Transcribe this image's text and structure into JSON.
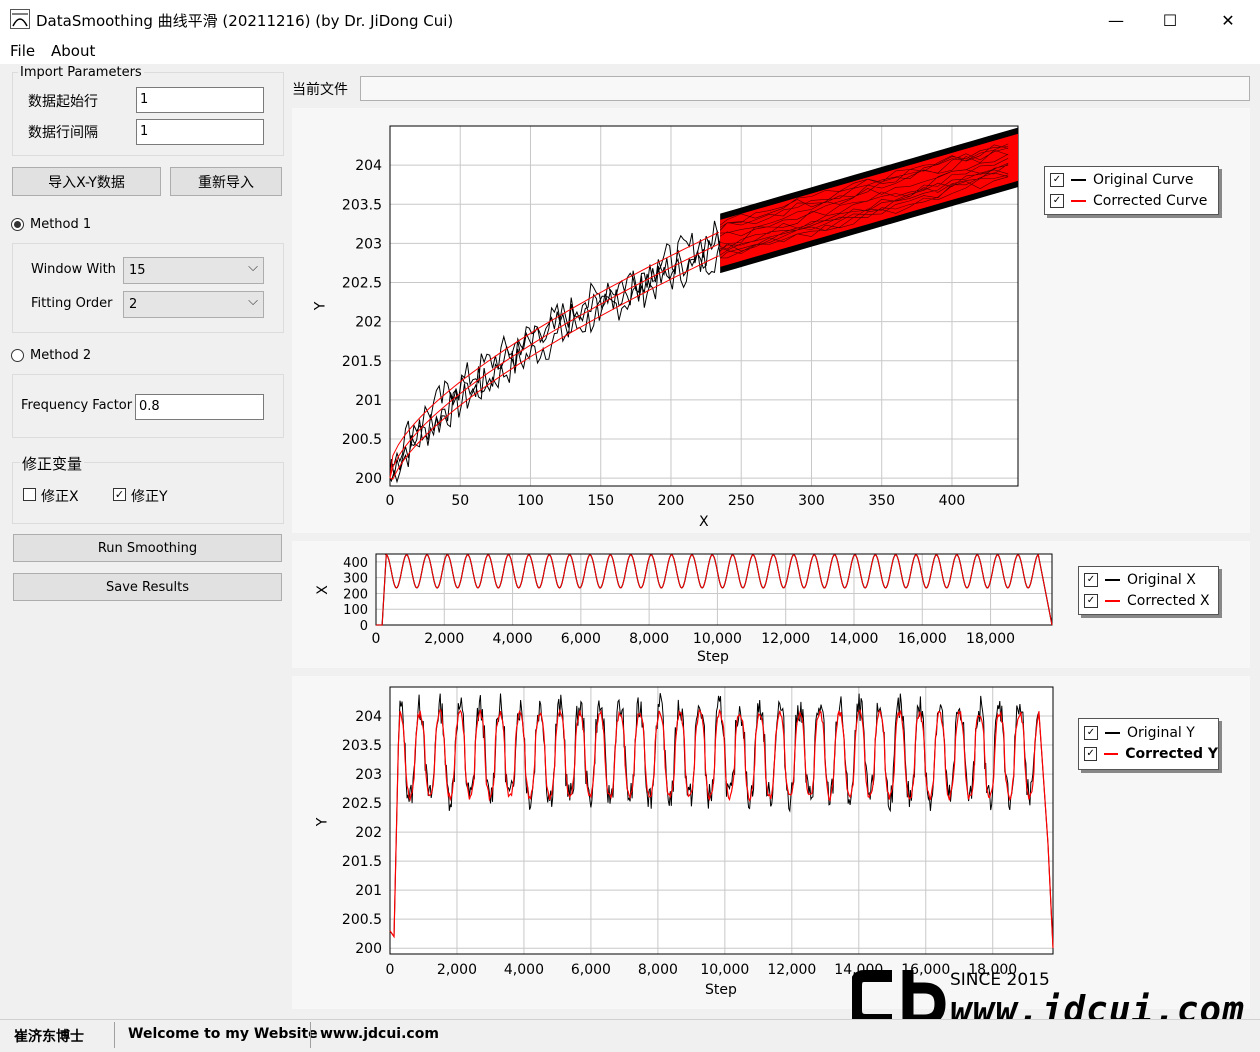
{
  "window": {
    "title": "DataSmoothing 曲线平滑 (20211216) (by Dr. JiDong Cui)",
    "minimize": "—",
    "maximize": "☐",
    "close": "✕"
  },
  "menu": [
    "File",
    "About"
  ],
  "import_params": {
    "title": "Import Parameters",
    "start_row_label": "数据起始行",
    "start_row_value": "1",
    "row_interval_label": "数据行间隔",
    "row_interval_value": "1"
  },
  "buttons": {
    "import_xy": "导入X-Y数据",
    "reimport": "重新导入",
    "run": "Run Smoothing",
    "save": "Save Results"
  },
  "method1": {
    "label": "Method 1",
    "selected": true,
    "window_label": "Window With",
    "window_value": "15",
    "order_label": "Fitting Order",
    "order_value": "2"
  },
  "method2": {
    "label": "Method 2",
    "selected": false,
    "freq_label": "Frequency Factor",
    "freq_value": "0.8"
  },
  "correction": {
    "title": "修正变量",
    "x_label": "修正X",
    "x_checked": false,
    "y_label": "修正Y",
    "y_checked": true
  },
  "current_file": {
    "label": "当前文件",
    "value": ""
  },
  "colors": {
    "original": "#000000",
    "corrected": "#ff0000",
    "grid": "#c8c8c8"
  },
  "chart_data": [
    {
      "type": "line",
      "xlabel": "X",
      "ylabel": "Y",
      "xlim": [
        0,
        447
      ],
      "ylim": [
        199.9,
        204.5
      ],
      "xticks": [
        "0",
        "50",
        "100",
        "150",
        "200",
        "250",
        "300",
        "350",
        "400"
      ],
      "yticks": [
        "200",
        "200.5",
        "201",
        "201.5",
        "202",
        "202.5",
        "203",
        "203.5",
        "204"
      ],
      "grid": true,
      "legend": "right",
      "series": [
        {
          "name": "Original Curve",
          "color": "#000000",
          "x": [
            0,
            20,
            50,
            80,
            120,
            150,
            200,
            235,
            300,
            350,
            400,
            447
          ],
          "y": [
            200,
            200.55,
            201.5,
            201.75,
            202.05,
            202.35,
            202.6,
            203.0,
            203.3,
            203.6,
            203.85,
            204.1
          ]
        },
        {
          "name": "Corrected Curve",
          "color": "#ff0000",
          "x": [
            0,
            20,
            50,
            80,
            120,
            150,
            200,
            235,
            300,
            350,
            400,
            447
          ],
          "y": [
            200,
            200.6,
            201.55,
            201.8,
            202.05,
            202.35,
            202.65,
            203.0,
            203.3,
            203.6,
            203.85,
            204.1
          ]
        }
      ]
    },
    {
      "type": "line",
      "xlabel": "Step",
      "ylabel": "X",
      "xlim": [
        0,
        19800
      ],
      "ylim": [
        0,
        450
      ],
      "xticks": [
        "0",
        "2,000",
        "4,000",
        "6,000",
        "8,000",
        "10,000",
        "12,000",
        "14,000",
        "16,000",
        "18,000"
      ],
      "yticks": [
        "0",
        "100",
        "200",
        "300",
        "400"
      ],
      "grid": true,
      "legend": "right",
      "series": [
        {
          "name": "Original X",
          "color": "#000000",
          "min": 235,
          "max": 445,
          "cycles": 32
        },
        {
          "name": "Corrected X",
          "color": "#ff0000",
          "min": 235,
          "max": 445,
          "cycles": 32
        }
      ]
    },
    {
      "type": "line",
      "xlabel": "Step",
      "ylabel": "Y",
      "xlim": [
        0,
        19800
      ],
      "ylim": [
        199.9,
        204.5
      ],
      "xticks": [
        "0",
        "2,000",
        "4,000",
        "6,000",
        "8,000",
        "10,000",
        "12,000",
        "14,000",
        "16,000",
        "18,000"
      ],
      "yticks": [
        "200",
        "200.5",
        "201",
        "201.5",
        "202",
        "202.5",
        "203",
        "203.5",
        "204"
      ],
      "grid": true,
      "legend": "right",
      "series": [
        {
          "name": "Original Y",
          "color": "#000000",
          "min": 202.6,
          "max": 204.15,
          "cycles": 32
        },
        {
          "name": "Corrected Y",
          "color": "#ff0000",
          "min": 202.6,
          "max": 204.05,
          "cycles": 32
        }
      ]
    }
  ],
  "watermark": {
    "since": "SINCE 2015",
    "site": "www.jdcui.com"
  },
  "statusbar": {
    "author": "崔济东博士",
    "welcome": "Welcome to my Website",
    "url": "www.jdcui.com"
  }
}
